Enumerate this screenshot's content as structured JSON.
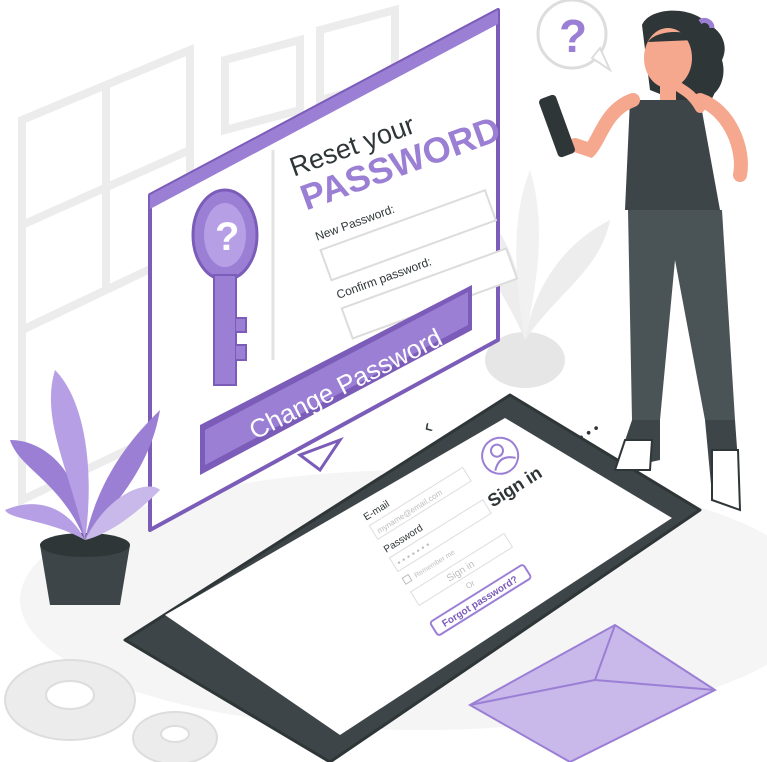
{
  "reset_card": {
    "title_line1": "Reset your",
    "title_line2": "PASSWORD",
    "new_password_label": "New Password:",
    "confirm_password_label": "Confirm password:",
    "button_label": "Change Password"
  },
  "phone": {
    "back_glyph": "‹",
    "menu_glyph": "• • •",
    "title": "Sign in",
    "email_label": "E-mail",
    "email_placeholder": "myname@email.com",
    "password_label": "Password",
    "password_mask": "• • • • • • •",
    "remember_label": "Remember me",
    "signin_button": "Sign in",
    "or_text": "Or",
    "forgot_link": "Forgot password?"
  },
  "thought_bubble": {
    "glyph": "?"
  },
  "key": {
    "glyph": "?"
  },
  "colors": {
    "accent": "#9b7fd4",
    "accent_dark": "#7b5cb8",
    "accent_light": "#c9b8ea",
    "phone_body": "#3d4548",
    "outline": "#2f3638",
    "gray_light": "#ebebeb"
  },
  "icons": [
    "question-bubble-icon",
    "key-icon",
    "user-avatar-icon",
    "envelope-icon",
    "gear-icon"
  ]
}
